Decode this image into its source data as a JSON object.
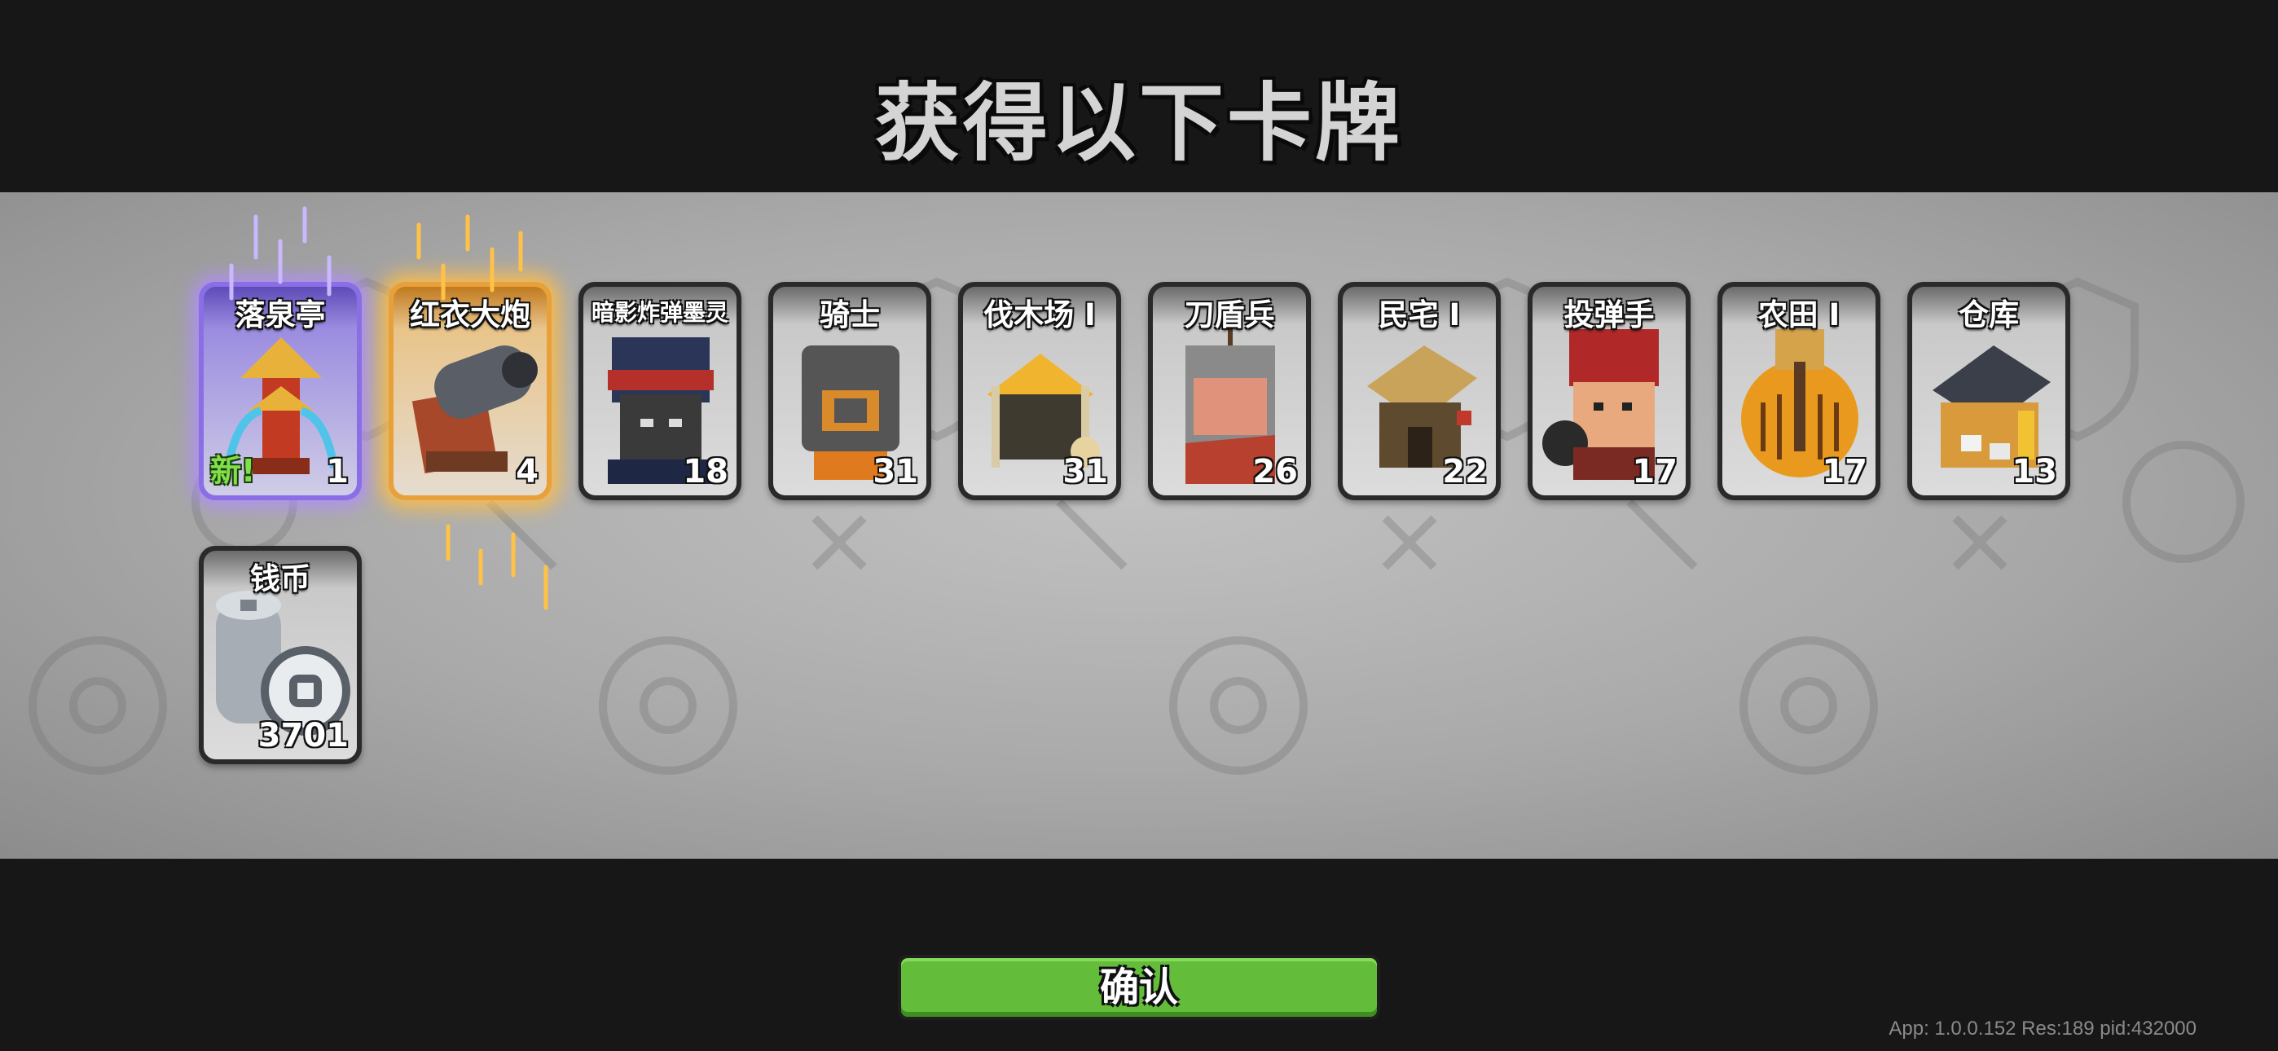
{
  "header": {
    "title": "获得以下卡牌"
  },
  "cards": [
    {
      "name": "落泉亭",
      "count": "1",
      "badge": "新!",
      "rarity": "epic",
      "icon": "fountain-pavilion-icon",
      "color": "#e04a2a"
    },
    {
      "name": "红衣大炮",
      "count": "4",
      "rarity": "legendary",
      "icon": "red-cannon-icon",
      "color": "#5a5e66"
    },
    {
      "name": "暗影炸弹墨灵",
      "count": "18",
      "rarity": "common",
      "icon": "shadow-bomber-icon",
      "color": "#2a3558"
    },
    {
      "name": "骑士",
      "count": "31",
      "rarity": "common",
      "icon": "knight-icon",
      "color": "#555555"
    },
    {
      "name": "伐木场 Ⅰ",
      "count": "31",
      "rarity": "common",
      "icon": "lumber-mill-icon",
      "color": "#f1b42e"
    },
    {
      "name": "刀盾兵",
      "count": "26",
      "rarity": "common",
      "icon": "shield-soldier-icon",
      "color": "#b8402e"
    },
    {
      "name": "民宅 Ⅰ",
      "count": "22",
      "rarity": "common",
      "icon": "house-icon",
      "color": "#c9a35a"
    },
    {
      "name": "投弹手",
      "count": "17",
      "rarity": "common",
      "icon": "bomber-icon",
      "color": "#b02828"
    },
    {
      "name": "农田 Ⅰ",
      "count": "17",
      "rarity": "common",
      "icon": "farm-icon",
      "color": "#e99a1e"
    },
    {
      "name": "仓库",
      "count": "13",
      "rarity": "common",
      "icon": "warehouse-icon",
      "color": "#d89a3a"
    },
    {
      "name": "钱币",
      "count": "3701",
      "rarity": "common",
      "icon": "coin-stack-icon",
      "color": "#a7adb4"
    }
  ],
  "footer": {
    "confirm_label": "确认",
    "build_info": "App: 1.0.0.152 Res:189 pid:432000"
  },
  "colors": {
    "confirm": "#63bd3b",
    "epic_glow": "#8a6ee6",
    "legendary_glow": "#e8a13a",
    "new_badge": "#7fe04a"
  }
}
